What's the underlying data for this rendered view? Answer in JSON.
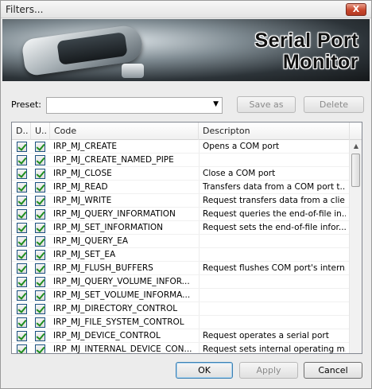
{
  "window": {
    "title": "Filters...",
    "close_label": "X"
  },
  "banner": {
    "line1": "Serial Port",
    "line2": "Monitor"
  },
  "preset": {
    "label": "Preset:",
    "value": "",
    "save_label": "Save as",
    "delete_label": "Delete"
  },
  "table": {
    "headers": {
      "d": "D..",
      "u": "U..",
      "code": "Code",
      "desc": "Descripton"
    },
    "rows": [
      {
        "code": "IRP_MJ_CREATE",
        "desc": "Opens a COM port"
      },
      {
        "code": "IRP_MJ_CREATE_NAMED_PIPE",
        "desc": ""
      },
      {
        "code": "IRP_MJ_CLOSE",
        "desc": "Close a COM port"
      },
      {
        "code": "IRP_MJ_READ",
        "desc": "Transfers data from a COM port t..."
      },
      {
        "code": "IRP_MJ_WRITE",
        "desc": "Request transfers data from a clie..."
      },
      {
        "code": "IRP_MJ_QUERY_INFORMATION",
        "desc": "Request queries the end-of-file in..."
      },
      {
        "code": "IRP_MJ_SET_INFORMATION",
        "desc": "Request sets the end-of-file infor..."
      },
      {
        "code": "IRP_MJ_QUERY_EA",
        "desc": ""
      },
      {
        "code": "IRP_MJ_SET_EA",
        "desc": ""
      },
      {
        "code": "IRP_MJ_FLUSH_BUFFERS",
        "desc": "Request flushes COM port's intern..."
      },
      {
        "code": "IRP_MJ_QUERY_VOLUME_INFOR...",
        "desc": ""
      },
      {
        "code": "IRP_MJ_SET_VOLUME_INFORMA...",
        "desc": ""
      },
      {
        "code": "IRP_MJ_DIRECTORY_CONTROL",
        "desc": ""
      },
      {
        "code": "IRP_MJ_FILE_SYSTEM_CONTROL",
        "desc": ""
      },
      {
        "code": "IRP_MJ_DEVICE_CONTROL",
        "desc": "Request operates a serial port"
      },
      {
        "code": "IRP_MJ_INTERNAL_DEVICE_CON...",
        "desc": "Request sets internal operating m..."
      }
    ]
  },
  "footer": {
    "ok_label": "OK",
    "apply_label": "Apply",
    "cancel_label": "Cancel"
  }
}
